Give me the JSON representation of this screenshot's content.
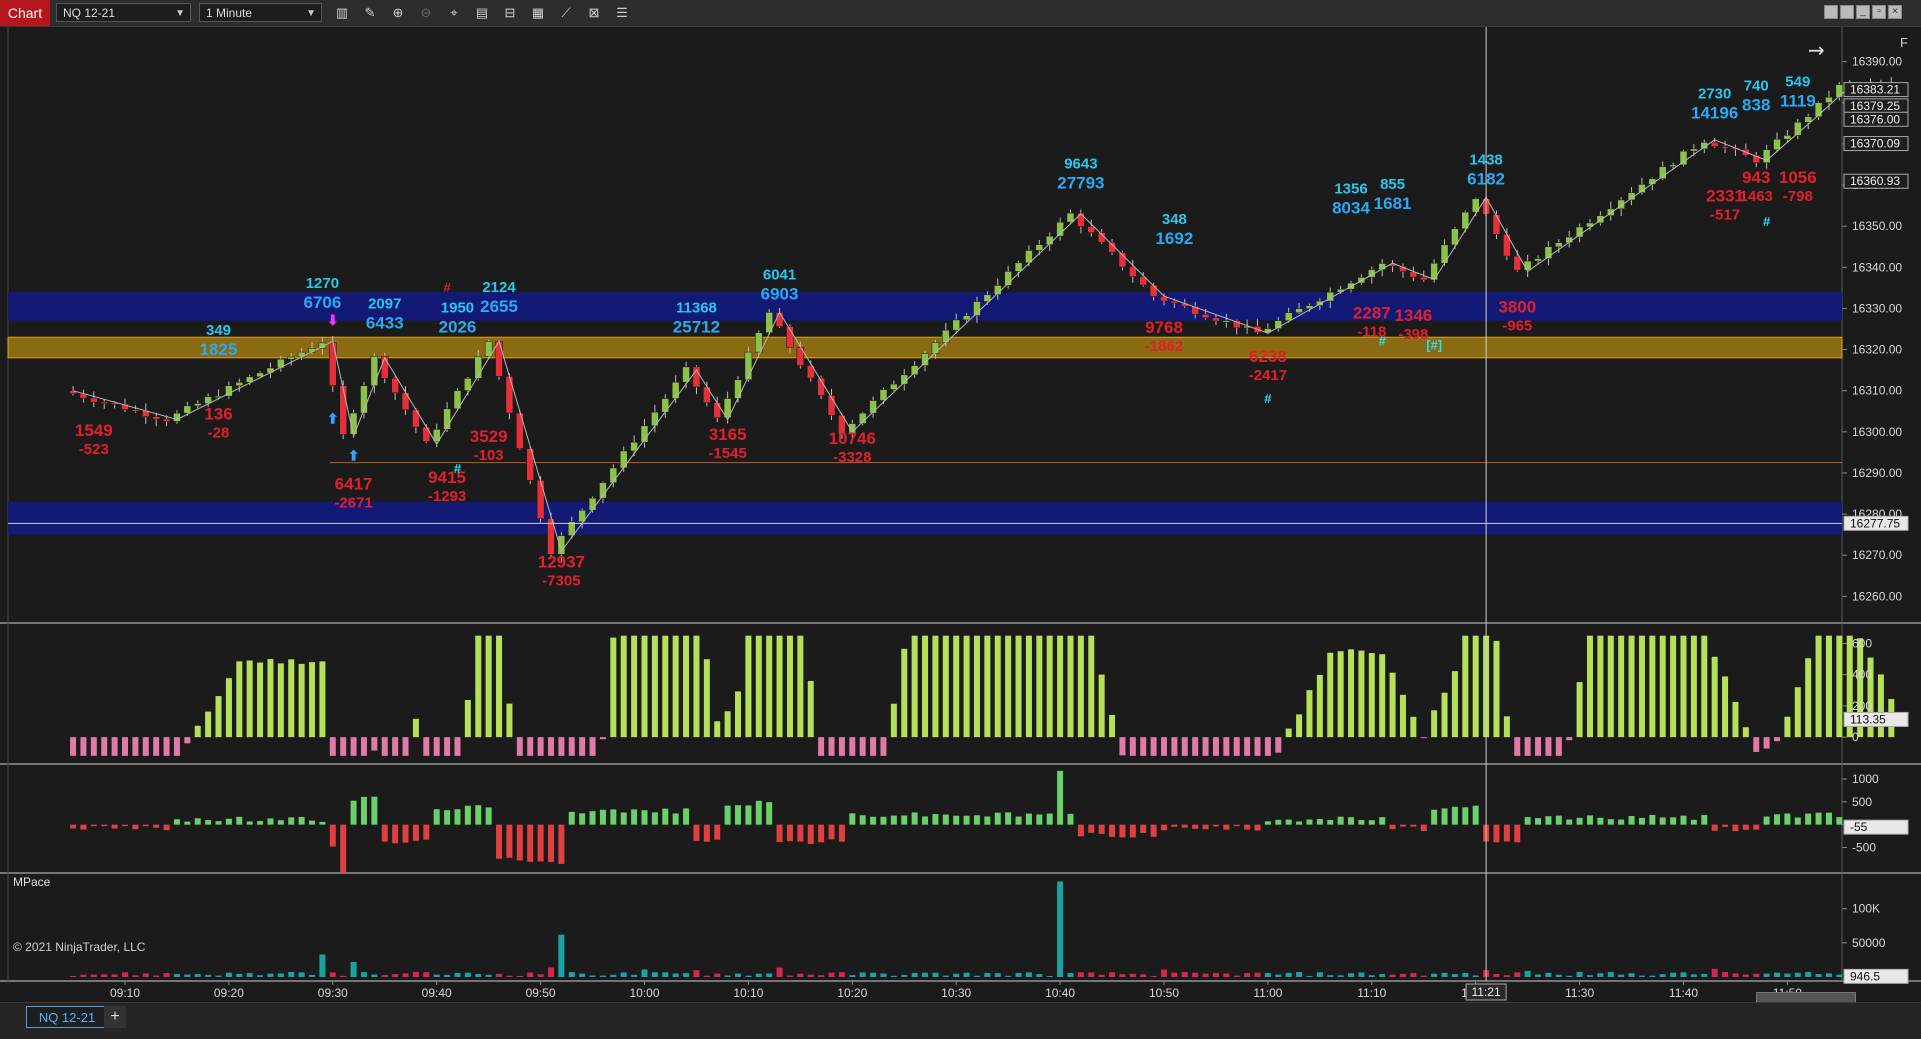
{
  "toolbar": {
    "chart_label": "Chart",
    "instrument": "NQ 12-21",
    "interval": "1 Minute"
  },
  "bottom": {
    "instrument_tab": "NQ 12-21",
    "add_tab": "+"
  },
  "colors": {
    "bull": "#8bc34a",
    "bear": "#e5303a",
    "cyan_label": "#27c7f0",
    "red_label": "#e0202c",
    "zone_blue": "#121a7a",
    "zone_gold": "#8a6b12"
  },
  "chart_data": {
    "type": "candlestick",
    "instrument": "NQ 12-21",
    "interval": "1 Minute",
    "copyright": "© 2021 NinjaTrader, LLC",
    "f_marker": "F",
    "x_ticks": [
      "09:10",
      "09:20",
      "09:30",
      "09:40",
      "09:50",
      "10:00",
      "10:10",
      "10:20",
      "10:30",
      "10:40",
      "10:50",
      "11:00",
      "11:10",
      "11:20",
      "11:30",
      "11:40",
      "11:50"
    ],
    "crosshair_time": "11:21",
    "price_axis": {
      "ticks": [
        "16390.00",
        "16380.00",
        "16370.00",
        "16360.00",
        "16350.00",
        "16340.00",
        "16330.00",
        "16320.00",
        "16310.00",
        "16300.00",
        "16290.00",
        "16280.00",
        "16270.00",
        "16260.00"
      ],
      "range": [
        16254,
        16396
      ],
      "markers": [
        {
          "value": 16383.21,
          "label": "16383.21"
        },
        {
          "value": 16379.25,
          "label": "16379.25"
        },
        {
          "value": 16376.0,
          "label": "16376.00"
        },
        {
          "value": 16370.09,
          "label": "16370.09"
        },
        {
          "value": 16360.93,
          "label": "16360.93"
        },
        {
          "value": 16277.75,
          "label": "16277.75"
        }
      ]
    },
    "zones": [
      {
        "type": "blue",
        "low": 16327,
        "high": 16334
      },
      {
        "type": "gold",
        "low": 16318,
        "high": 16323
      },
      {
        "type": "blue",
        "low": 16275,
        "high": 16283
      }
    ],
    "horizontal_lines": [
      16292.5
    ],
    "crosshair_price": 16277.75,
    "cyan_labels": [
      {
        "time": "09:19",
        "price": 16323.5,
        "volume": "349",
        "delta": "1825"
      },
      {
        "time": "09:29",
        "price": 16335,
        "volume": "1270",
        "delta": "6706"
      },
      {
        "time": "09:35",
        "price": 16330,
        "volume": "2097",
        "delta": "6433"
      },
      {
        "time": "09:42",
        "price": 16329,
        "volume": "1950",
        "delta": "2026"
      },
      {
        "time": "09:46",
        "price": 16334,
        "volume": "2124",
        "delta": "2655"
      },
      {
        "time": "10:05",
        "price": 16329,
        "volume": "11368",
        "delta": "25712"
      },
      {
        "time": "10:13",
        "price": 16337,
        "volume": "6041",
        "delta": "6903"
      },
      {
        "time": "10:42",
        "price": 16364,
        "volume": "9643",
        "delta": "27793"
      },
      {
        "time": "10:51",
        "price": 16350.5,
        "volume": "348",
        "delta": "1692"
      },
      {
        "time": "11:08",
        "price": 16358,
        "volume": "1356",
        "delta": "8034"
      },
      {
        "time": "11:12",
        "price": 16359,
        "volume": "855",
        "delta": "1681"
      },
      {
        "time": "11:21",
        "price": 16365,
        "volume": "1438",
        "delta": "6182"
      },
      {
        "time": "11:43",
        "price": 16381,
        "volume": "2730",
        "delta": "14196"
      },
      {
        "time": "11:47",
        "price": 16383,
        "volume": "740",
        "delta": "838"
      },
      {
        "time": "11:51",
        "price": 16384,
        "volume": "549",
        "delta": "1119"
      }
    ],
    "red_labels": [
      {
        "time": "09:07",
        "price": 16299,
        "volume": "1549",
        "delta": "-523"
      },
      {
        "time": "09:19",
        "price": 16303,
        "volume": "136",
        "delta": "-28"
      },
      {
        "time": "09:32",
        "price": 16286,
        "volume": "6417",
        "delta": "-2671"
      },
      {
        "time": "09:41",
        "price": 16287.5,
        "volume": "9415",
        "delta": "-1293"
      },
      {
        "time": "09:45",
        "price": 16297.5,
        "volume": "3529",
        "delta": "-103"
      },
      {
        "time": "09:52",
        "price": 16267,
        "volume": "12937",
        "delta": "-7305"
      },
      {
        "time": "10:08",
        "price": 16298,
        "volume": "3165",
        "delta": "-1545"
      },
      {
        "time": "10:20",
        "price": 16297,
        "volume": "10746",
        "delta": "-3328"
      },
      {
        "time": "10:50",
        "price": 16324,
        "volume": "9768",
        "delta": "-1862"
      },
      {
        "time": "11:00",
        "price": 16317,
        "volume": "6238",
        "delta": "-2417"
      },
      {
        "time": "11:10",
        "price": 16327.5,
        "volume": "2287",
        "delta": "-118"
      },
      {
        "time": "11:14",
        "price": 16327,
        "volume": "1346",
        "delta": "-398"
      },
      {
        "time": "11:24",
        "price": 16329,
        "volume": "3800",
        "delta": "-965"
      },
      {
        "time": "11:44",
        "price": 16356,
        "volume": "2331",
        "delta": "-517"
      },
      {
        "time": "11:47",
        "price": 16360.5,
        "volume": "943",
        "delta": "1463"
      },
      {
        "time": "11:51",
        "price": 16360.5,
        "volume": "1056",
        "delta": "-798"
      }
    ],
    "hash_markers": [
      {
        "time": "09:42",
        "price": 16290,
        "text": "#",
        "color": "cyan"
      },
      {
        "time": "09:41",
        "price": 16334,
        "text": "#",
        "color": "red"
      },
      {
        "time": "11:00",
        "price": 16307,
        "text": "#",
        "color": "cyan"
      },
      {
        "time": "11:11",
        "price": 16321,
        "text": "#",
        "color": "cyan"
      },
      {
        "time": "11:16",
        "price": 16320,
        "text": "[#]",
        "color": "cyan"
      },
      {
        "time": "11:48",
        "price": 16350,
        "text": "#",
        "color": "cyan"
      }
    ],
    "arrows": [
      {
        "time": "09:30",
        "price": 16326,
        "dir": "down",
        "color": "magenta"
      },
      {
        "time": "09:30",
        "price": 16302,
        "dir": "up",
        "color": "blue"
      },
      {
        "time": "09:32",
        "price": 16293,
        "dir": "up",
        "color": "blue"
      }
    ],
    "zigzag": [
      {
        "time": "09:05",
        "price": 16310
      },
      {
        "time": "09:15",
        "price": 16303
      },
      {
        "time": "09:30",
        "price": 16322
      },
      {
        "time": "09:32",
        "price": 16299
      },
      {
        "time": "09:35",
        "price": 16318
      },
      {
        "time": "09:40",
        "price": 16297
      },
      {
        "time": "09:46",
        "price": 16322
      },
      {
        "time": "09:52",
        "price": 16271
      },
      {
        "time": "10:05",
        "price": 16315
      },
      {
        "time": "10:08",
        "price": 16303
      },
      {
        "time": "10:13",
        "price": 16329
      },
      {
        "time": "10:20",
        "price": 16300
      },
      {
        "time": "10:42",
        "price": 16353
      },
      {
        "time": "10:50",
        "price": 16333
      },
      {
        "time": "11:00",
        "price": 16324
      },
      {
        "time": "11:12",
        "price": 16341
      },
      {
        "time": "11:16",
        "price": 16337
      },
      {
        "time": "11:21",
        "price": 16357
      },
      {
        "time": "11:25",
        "price": 16339
      },
      {
        "time": "11:43",
        "price": 16371
      },
      {
        "time": "11:48",
        "price": 16366
      },
      {
        "time": "11:53",
        "price": 16377
      },
      {
        "time": "11:56",
        "price": 16384
      }
    ],
    "candle_count": 176,
    "panels": [
      {
        "name": "delta-oscillator",
        "ticks": [
          "600",
          "400",
          "200",
          "0"
        ],
        "marker": "113.35",
        "marker_value": 113.35,
        "range": [
          -140,
          680
        ]
      },
      {
        "name": "bar-delta",
        "ticks": [
          "1000",
          "500",
          "0",
          "-500"
        ],
        "marker": "-55",
        "marker_value": -55,
        "range": [
          -950,
          1220
        ]
      },
      {
        "name": "mpace",
        "title": "MPace",
        "ticks": [
          "100K",
          "50000"
        ],
        "marker": "946.5",
        "marker_value": 946.5,
        "range": [
          0,
          145000
        ]
      }
    ]
  }
}
